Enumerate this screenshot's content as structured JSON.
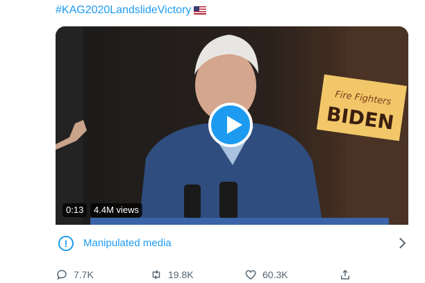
{
  "tweet": {
    "hashtag": "#KAG2020LandslideVictory",
    "flag_icon": "us-flag-icon"
  },
  "media": {
    "duration": "0:13",
    "views": "4.4M views",
    "sign_line1": "Fire Fighters",
    "sign_line2": "BIDEN",
    "play_icon": "play-icon",
    "colors": {
      "accent": "#1d9bf0",
      "sign": "#f2c76a"
    }
  },
  "notice": {
    "label": "Manipulated media",
    "icon": "exclamation-circle-icon",
    "chevron": "chevron-right-icon"
  },
  "actions": {
    "reply_count": "7.7K",
    "retweet_count": "19.8K",
    "like_count": "60.3K",
    "reply_icon": "reply-icon",
    "retweet_icon": "retweet-icon",
    "like_icon": "heart-icon",
    "share_icon": "share-icon"
  }
}
